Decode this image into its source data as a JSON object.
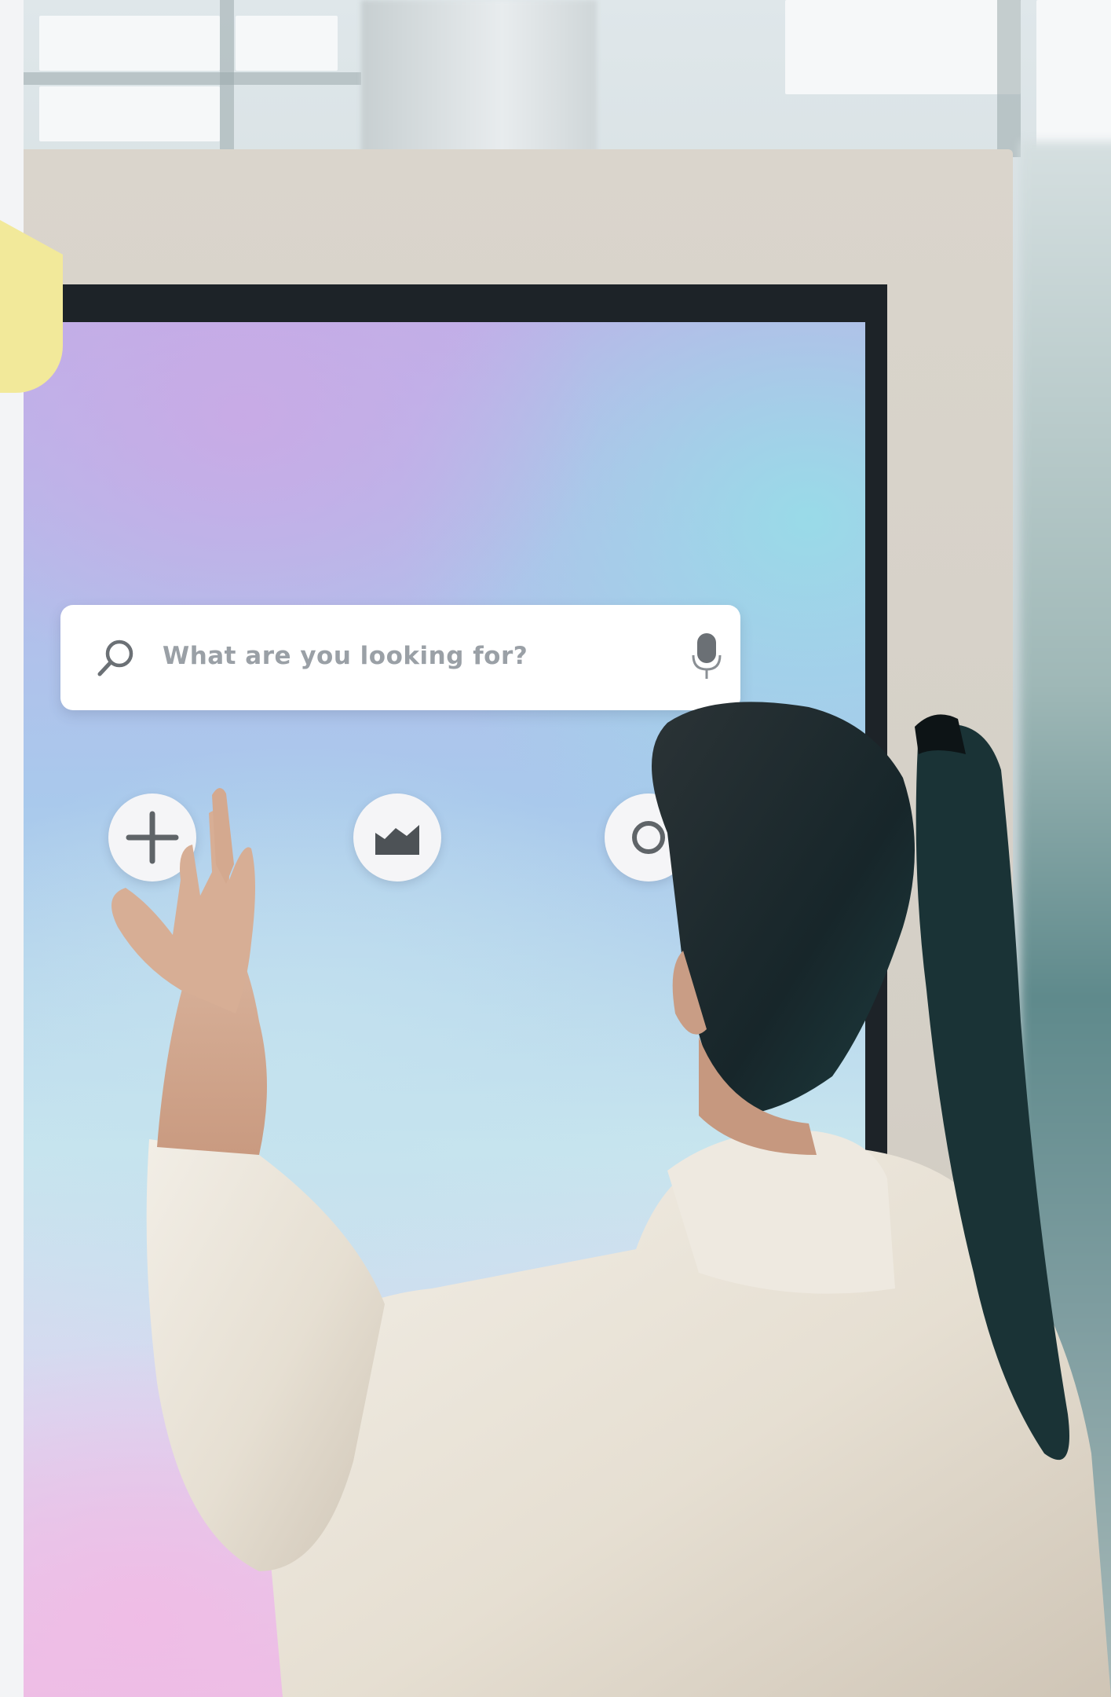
{
  "search": {
    "placeholder": "What are you looking for?"
  },
  "icons": {
    "search": "search-icon",
    "mic": "microphone-icon",
    "add": "plus-icon",
    "chart": "area-chart-icon"
  },
  "colors": {
    "screen_top": "#bfb0e8",
    "screen_bottom": "#ebbfe4",
    "kiosk_frame": "#d6d1c8",
    "search_bar": "#ffffff",
    "placeholder_text": "#9aa0a6",
    "hair": "#1c2a2c",
    "sweater": "#ece6da"
  }
}
